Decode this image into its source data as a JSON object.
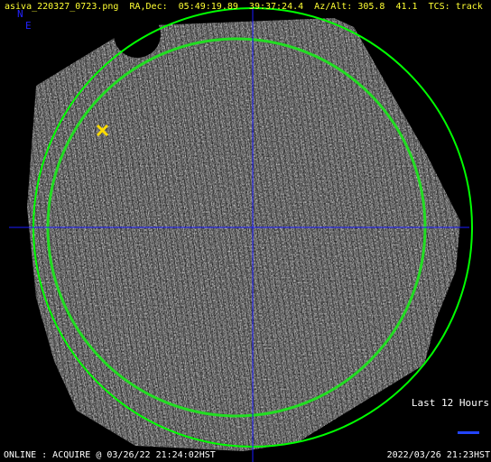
{
  "header": {
    "filename": "asiva_220327_0723.png",
    "radec_label": "RA,Dec:",
    "ra": "05:49:19.89",
    "dec": "39:37:24.4",
    "azalt_label": "Az/Alt:",
    "az": "305.8",
    "alt": "41.1",
    "tcs_label": "TCS:",
    "tcs_state": "track"
  },
  "header_line": "asiva_220327_0723.png  RA,Dec:  05:49:19.89  39:37:24.4  Az/Alt: 305.8  41.1  TCS: track",
  "orientation": {
    "north": "N",
    "east": "E"
  },
  "legend": {
    "label": "Last 12 Hours",
    "track_color": "#2244ff"
  },
  "status": {
    "left": "ONLINE : ACQUIRE @ 03/26/22 21:24:02HST",
    "right": "2022/03/26 21:23HST"
  },
  "marker": {
    "symbol": "✕",
    "color": "#ffdd00"
  },
  "colors": {
    "annotation": "#ffff33",
    "horizon_circle": "#00ff00",
    "inner_circle": "#22dd22",
    "crosshair": "#1a1aff",
    "background": "#000000"
  }
}
